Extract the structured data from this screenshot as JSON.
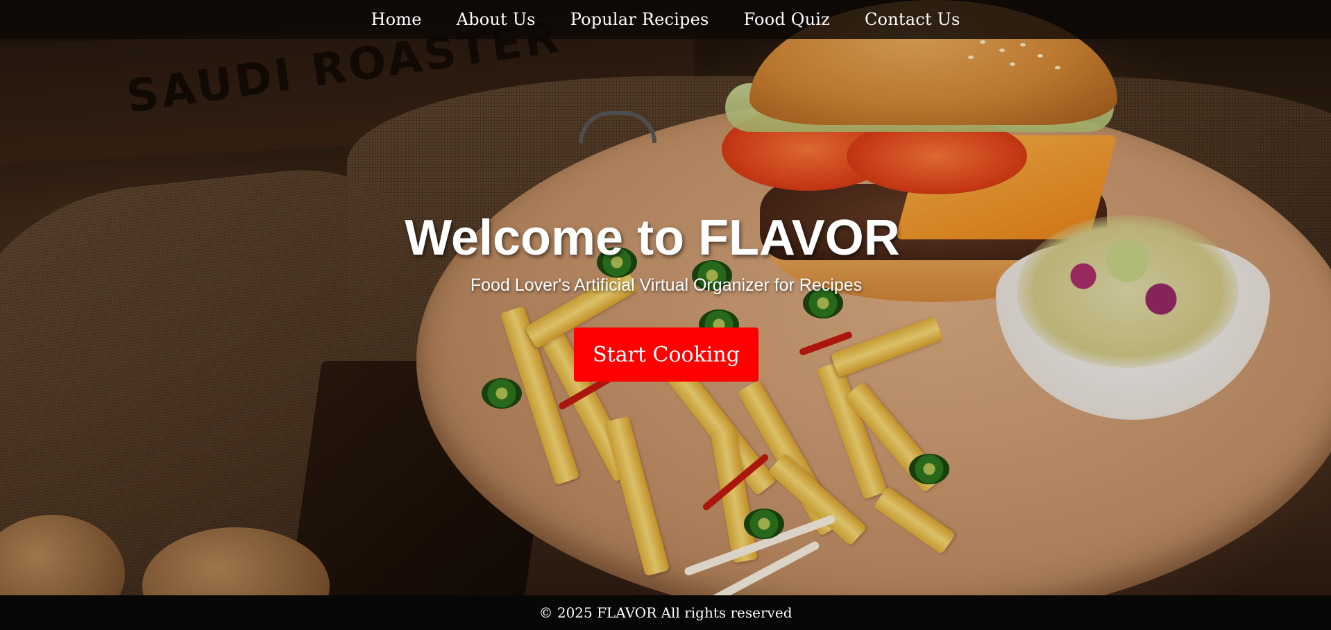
{
  "nav": {
    "items": [
      {
        "label": "Home"
      },
      {
        "label": "About Us"
      },
      {
        "label": "Popular Recipes"
      },
      {
        "label": "Food Quiz"
      },
      {
        "label": "Contact Us"
      }
    ]
  },
  "hero": {
    "title": "Welcome to FLAVOR",
    "subtitle": "Food Lover's Artificial Virtual Organizer for Recipes",
    "cta_label": "Start Cooking",
    "background_image": "burger-and-fries-photo",
    "crate_text": "SAUDI ROASTER"
  },
  "footer": {
    "copyright": "© 2025 FLAVOR All rights reserved"
  },
  "colors": {
    "nav_background": "#0c0806",
    "cta_background": "#ff0000",
    "footer_background": "#070707",
    "text": "#ffffff"
  }
}
